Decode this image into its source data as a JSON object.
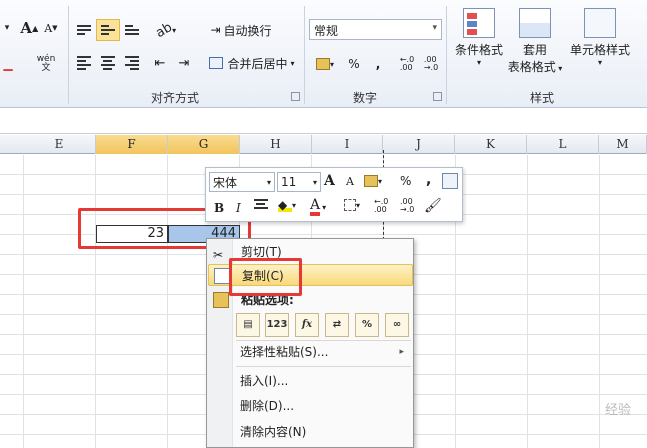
{
  "ribbon": {
    "wrap_text": "自动换行",
    "merge_center": "合并后居中",
    "number_format": "常规",
    "percent": "%",
    "comma": ",",
    "dec_inc": "←.0\n.00",
    "dec_dec": ".00\n→.0",
    "conditional_format": "条件格式",
    "table_format_1": "套用",
    "table_format_2": "表格格式",
    "cell_style": "单元格样式",
    "groups": {
      "alignment": "对齐方式",
      "number": "数字",
      "styles": "样式"
    },
    "font_a": "A",
    "wen": "wén\n文"
  },
  "columns": [
    "E",
    "F",
    "G",
    "H",
    "I",
    "J",
    "K",
    "L",
    "M"
  ],
  "cells": {
    "f": "23",
    "g": "444"
  },
  "minibar": {
    "font_name": "宋体",
    "font_size": "11",
    "bold": "B",
    "italic": "I",
    "percent": "%",
    "comma": ","
  },
  "context_menu": {
    "cut": "剪切(T)",
    "copy": "复制(C)",
    "paste_options": "粘贴选项:",
    "paste_special": "选择性粘贴(S)...",
    "insert": "插入(I)...",
    "delete": "删除(D)...",
    "clear": "清除内容(N)",
    "paste_123": "123",
    "paste_fx": "fx",
    "paste_pct": "%"
  },
  "watermark": "经验",
  "colors": {
    "highlight": "#f9d979",
    "selection": "#a7c6ea",
    "red_box": "#e53935",
    "column_selected": "#f2c45d"
  }
}
